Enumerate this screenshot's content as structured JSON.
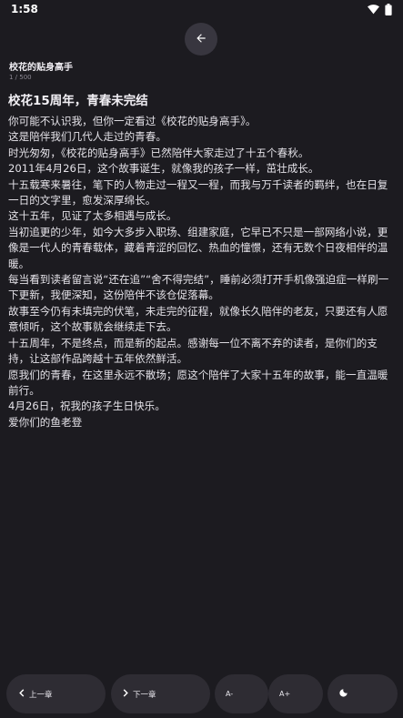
{
  "status_bar": {
    "time": "1:58"
  },
  "header": {
    "back_icon": "arrow-left-icon",
    "book_title": "校花的贴身高手",
    "page_counter": "1 / 500"
  },
  "chapter": {
    "title": "校花15周年，青春未完结",
    "paragraphs": [
      "你可能不认识我，但你一定看过《校花的贴身高手》。",
      "这是陪伴我们几代人走过的青春。",
      "时光匆匆，《校花的贴身高手》已然陪伴大家走过了十五个春秋。",
      "2011年4月26日，这个故事诞生，就像我的孩子一样，茁壮成长。",
      "十五载寒来暑往，笔下的人物走过一程又一程，而我与万千读者的羁绊，也在日复一日的文字里，愈发深厚绵长。",
      "这十五年，见证了太多相遇与成长。",
      "当初追更的少年，如今大多步入职场、组建家庭，它早已不只是一部网络小说，更像是一代人的青春载体，藏着青涩的回忆、热血的憧憬，还有无数个日夜相伴的温暖。",
      "每当看到读者留言说“还在追”“舍不得完结”，睡前必须打开手机像强迫症一样刷一下更新，我便深知，这份陪伴不该仓促落幕。",
      "故事至今仍有未填完的伏笔，未走完的征程，就像长久陪伴的老友，只要还有人愿意倾听，这个故事就会继续走下去。",
      "十五周年，不是终点，而是新的起点。感谢每一位不离不弃的读者，是你们的支持，让这部作品跨越十五年依然鲜活。",
      "愿我们的青春，在这里永远不散场；愿这个陪伴了大家十五年的故事，能一直温暖前行。",
      "4月26日，祝我的孩子生日快乐。",
      "爱你们的鱼老登"
    ]
  },
  "bottom_bar": {
    "prev_icon": "chevron-left-icon",
    "prev_label": "上一章",
    "next_icon": "chevron-right-icon",
    "next_label": "下一章",
    "font_decrease_label": "A-",
    "font_increase_label": "A+",
    "theme_icon": "moon-icon"
  }
}
